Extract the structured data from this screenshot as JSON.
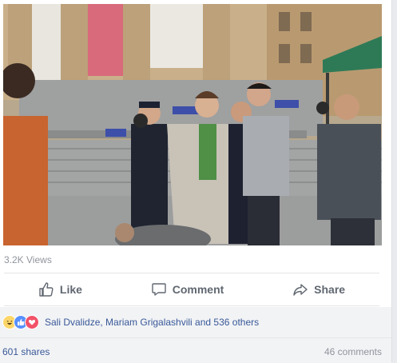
{
  "post": {
    "views": "3.2K Views",
    "actions": {
      "like": "Like",
      "comment": "Comment",
      "share": "Share"
    },
    "reactions": {
      "icons": [
        "haha-icon",
        "like-icon",
        "love-icon"
      ],
      "summary": "Sali Dvalidze, Mariam Grigalashvili and 536 others"
    },
    "shares": "601 shares",
    "comments": "46 comments"
  },
  "colors": {
    "link": "#385898",
    "muted": "#90949c",
    "like_blue": "#5890ff",
    "love_red": "#f25268",
    "haha_yellow": "#fcd669"
  }
}
